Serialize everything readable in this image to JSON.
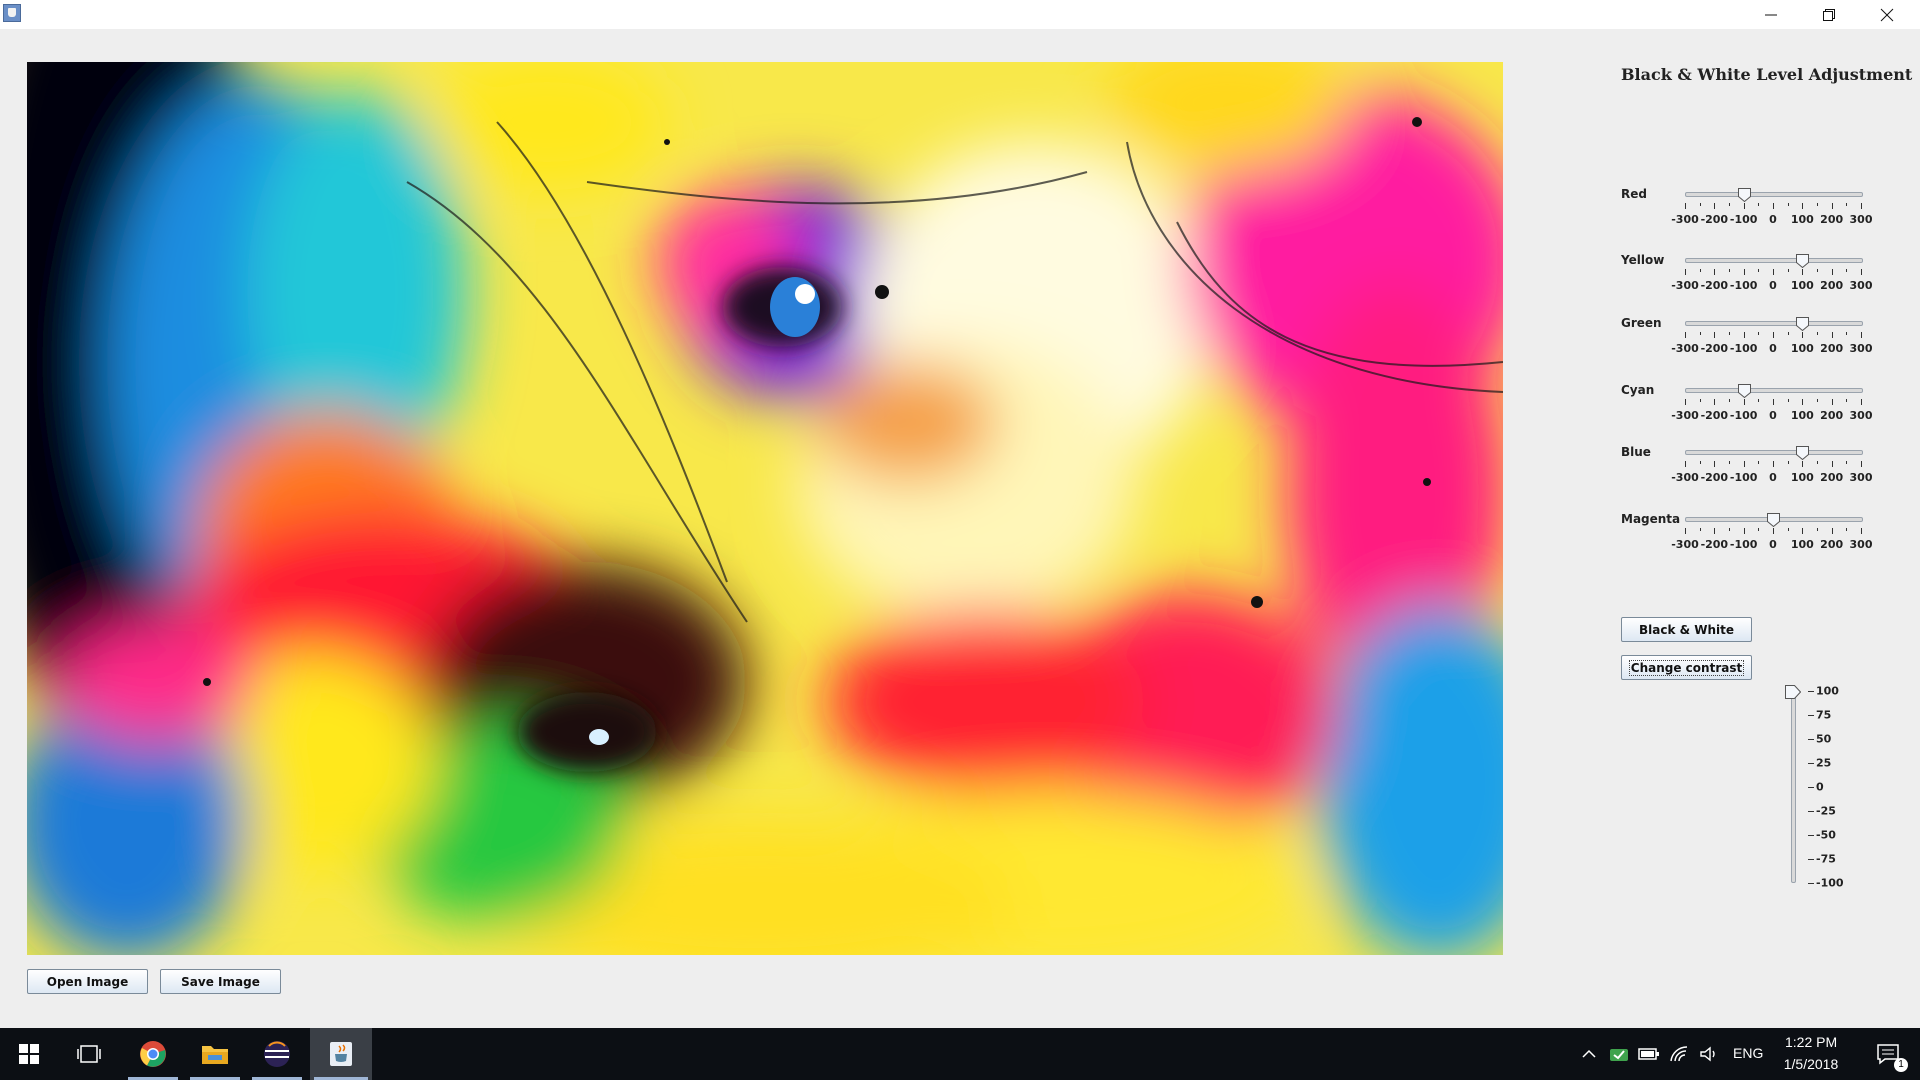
{
  "window": {
    "app_icon": "java-coffee-icon",
    "minimize_icon": "minimize-icon",
    "restore_icon": "restore-icon",
    "close_icon": "close-icon"
  },
  "image": {
    "description_icon": "image-canvas"
  },
  "buttons": {
    "open": "Open Image",
    "save": "Save Image",
    "black_white": "Black & White",
    "change_contrast": "Change contrast"
  },
  "panel": {
    "title": "Black & White Level Adjustment"
  },
  "sliders": [
    {
      "label": "Red",
      "value": -100
    },
    {
      "label": "Yellow",
      "value": 100
    },
    {
      "label": "Green",
      "value": 100
    },
    {
      "label": "Cyan",
      "value": -100
    },
    {
      "label": "Blue",
      "value": 100
    },
    {
      "label": "Magenta",
      "value": 0
    }
  ],
  "slider_scale": {
    "min": -300,
    "max": 300,
    "labels": [
      "-300",
      "-200",
      "-100",
      "0",
      "100",
      "200",
      "300"
    ],
    "major_values": [
      -300,
      -200,
      -100,
      0,
      100,
      200,
      300
    ],
    "minor_step": 50
  },
  "contrast": {
    "value": 100,
    "min": -100,
    "max": 100,
    "labels": [
      "100",
      "75",
      "50",
      "25",
      "0",
      "-25",
      "-50",
      "-75",
      "-100"
    ],
    "label_values": [
      100,
      75,
      50,
      25,
      0,
      -25,
      -50,
      -75,
      -100
    ]
  },
  "taskbar": {
    "start_icon": "windows-start-icon",
    "task_view_icon": "task-view-icon",
    "apps": [
      "chrome-icon",
      "file-explorer-icon",
      "eclipse-icon",
      "java-icon"
    ],
    "tray_icons": [
      "chevron-up-icon",
      "shield-icon",
      "battery-icon",
      "wifi-icon",
      "volume-icon"
    ],
    "language": "ENG",
    "time": "1:22 PM",
    "date": "1/5/2018",
    "notification_count": "1"
  },
  "colors": {
    "background": "#eeeeee",
    "taskbar": "#0c0f14",
    "button_gradient_top": "#ffffff",
    "button_gradient_bottom": "#dde8f3"
  }
}
